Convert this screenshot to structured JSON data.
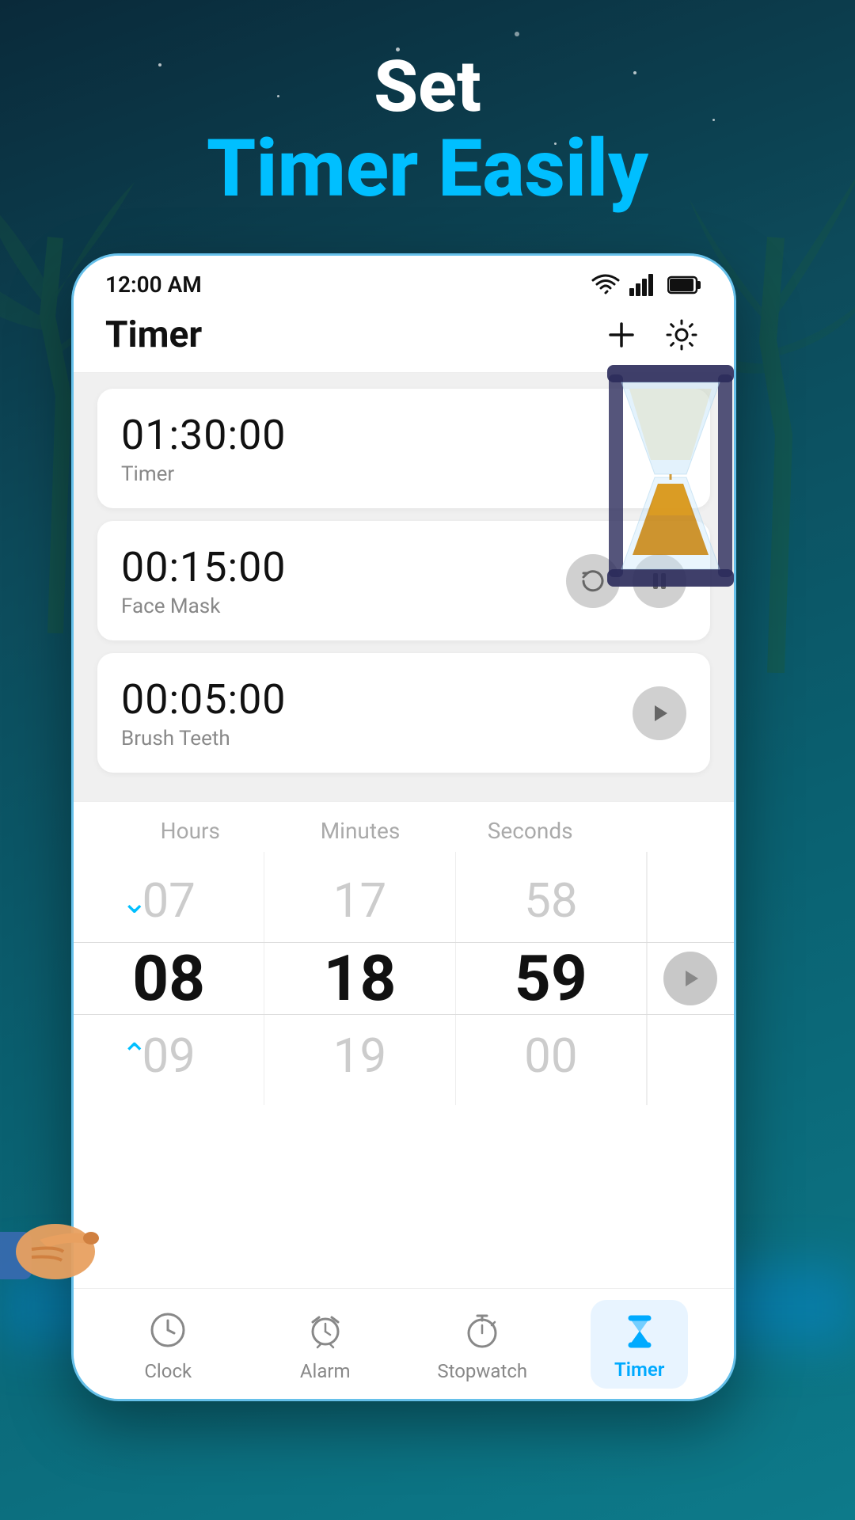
{
  "header": {
    "set_label": "Set",
    "timer_easily_label": "Timer Easily"
  },
  "status_bar": {
    "time": "12:00 AM"
  },
  "app": {
    "title": "Timer",
    "add_button": "+",
    "settings_button": "⚙"
  },
  "timers": [
    {
      "display": "01:30:00",
      "label": "Timer",
      "controls": []
    },
    {
      "display": "00:15:00",
      "label": "Face Mask",
      "controls": [
        "reset",
        "pause"
      ]
    },
    {
      "display": "00:05:00",
      "label": "Brush Teeth",
      "controls": [
        "play"
      ]
    }
  ],
  "picker": {
    "labels": [
      "Hours",
      "Minutes",
      "Seconds"
    ],
    "hours": {
      "prev": "07",
      "current": "08",
      "next": "09"
    },
    "minutes": {
      "prev": "17",
      "current": "18",
      "next": "19"
    },
    "seconds": {
      "prev": "58",
      "current": "59",
      "next": "00"
    }
  },
  "bottom_nav": {
    "items": [
      {
        "label": "Clock",
        "id": "clock"
      },
      {
        "label": "Alarm",
        "id": "alarm"
      },
      {
        "label": "Stopwatch",
        "id": "stopwatch"
      },
      {
        "label": "Timer",
        "id": "timer",
        "active": true
      }
    ]
  }
}
